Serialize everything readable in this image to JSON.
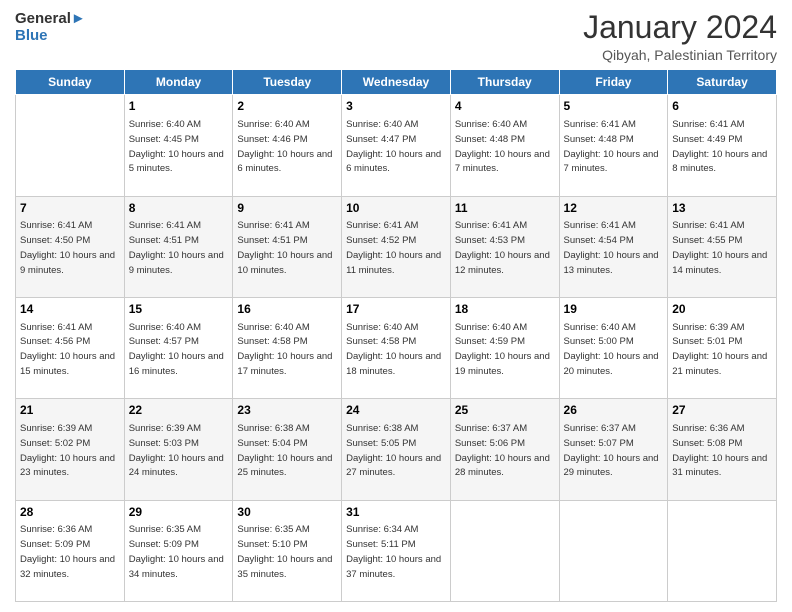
{
  "logo": {
    "text_general": "General",
    "text_blue": "Blue"
  },
  "header": {
    "month_year": "January 2024",
    "location": "Qibyah, Palestinian Territory"
  },
  "days_of_week": [
    "Sunday",
    "Monday",
    "Tuesday",
    "Wednesday",
    "Thursday",
    "Friday",
    "Saturday"
  ],
  "weeks": [
    [
      {
        "day": "",
        "sunrise": "",
        "sunset": "",
        "daylight": ""
      },
      {
        "day": "1",
        "sunrise": "Sunrise: 6:40 AM",
        "sunset": "Sunset: 4:45 PM",
        "daylight": "Daylight: 10 hours and 5 minutes."
      },
      {
        "day": "2",
        "sunrise": "Sunrise: 6:40 AM",
        "sunset": "Sunset: 4:46 PM",
        "daylight": "Daylight: 10 hours and 6 minutes."
      },
      {
        "day": "3",
        "sunrise": "Sunrise: 6:40 AM",
        "sunset": "Sunset: 4:47 PM",
        "daylight": "Daylight: 10 hours and 6 minutes."
      },
      {
        "day": "4",
        "sunrise": "Sunrise: 6:40 AM",
        "sunset": "Sunset: 4:48 PM",
        "daylight": "Daylight: 10 hours and 7 minutes."
      },
      {
        "day": "5",
        "sunrise": "Sunrise: 6:41 AM",
        "sunset": "Sunset: 4:48 PM",
        "daylight": "Daylight: 10 hours and 7 minutes."
      },
      {
        "day": "6",
        "sunrise": "Sunrise: 6:41 AM",
        "sunset": "Sunset: 4:49 PM",
        "daylight": "Daylight: 10 hours and 8 minutes."
      }
    ],
    [
      {
        "day": "7",
        "sunrise": "Sunrise: 6:41 AM",
        "sunset": "Sunset: 4:50 PM",
        "daylight": "Daylight: 10 hours and 9 minutes."
      },
      {
        "day": "8",
        "sunrise": "Sunrise: 6:41 AM",
        "sunset": "Sunset: 4:51 PM",
        "daylight": "Daylight: 10 hours and 9 minutes."
      },
      {
        "day": "9",
        "sunrise": "Sunrise: 6:41 AM",
        "sunset": "Sunset: 4:51 PM",
        "daylight": "Daylight: 10 hours and 10 minutes."
      },
      {
        "day": "10",
        "sunrise": "Sunrise: 6:41 AM",
        "sunset": "Sunset: 4:52 PM",
        "daylight": "Daylight: 10 hours and 11 minutes."
      },
      {
        "day": "11",
        "sunrise": "Sunrise: 6:41 AM",
        "sunset": "Sunset: 4:53 PM",
        "daylight": "Daylight: 10 hours and 12 minutes."
      },
      {
        "day": "12",
        "sunrise": "Sunrise: 6:41 AM",
        "sunset": "Sunset: 4:54 PM",
        "daylight": "Daylight: 10 hours and 13 minutes."
      },
      {
        "day": "13",
        "sunrise": "Sunrise: 6:41 AM",
        "sunset": "Sunset: 4:55 PM",
        "daylight": "Daylight: 10 hours and 14 minutes."
      }
    ],
    [
      {
        "day": "14",
        "sunrise": "Sunrise: 6:41 AM",
        "sunset": "Sunset: 4:56 PM",
        "daylight": "Daylight: 10 hours and 15 minutes."
      },
      {
        "day": "15",
        "sunrise": "Sunrise: 6:40 AM",
        "sunset": "Sunset: 4:57 PM",
        "daylight": "Daylight: 10 hours and 16 minutes."
      },
      {
        "day": "16",
        "sunrise": "Sunrise: 6:40 AM",
        "sunset": "Sunset: 4:58 PM",
        "daylight": "Daylight: 10 hours and 17 minutes."
      },
      {
        "day": "17",
        "sunrise": "Sunrise: 6:40 AM",
        "sunset": "Sunset: 4:58 PM",
        "daylight": "Daylight: 10 hours and 18 minutes."
      },
      {
        "day": "18",
        "sunrise": "Sunrise: 6:40 AM",
        "sunset": "Sunset: 4:59 PM",
        "daylight": "Daylight: 10 hours and 19 minutes."
      },
      {
        "day": "19",
        "sunrise": "Sunrise: 6:40 AM",
        "sunset": "Sunset: 5:00 PM",
        "daylight": "Daylight: 10 hours and 20 minutes."
      },
      {
        "day": "20",
        "sunrise": "Sunrise: 6:39 AM",
        "sunset": "Sunset: 5:01 PM",
        "daylight": "Daylight: 10 hours and 21 minutes."
      }
    ],
    [
      {
        "day": "21",
        "sunrise": "Sunrise: 6:39 AM",
        "sunset": "Sunset: 5:02 PM",
        "daylight": "Daylight: 10 hours and 23 minutes."
      },
      {
        "day": "22",
        "sunrise": "Sunrise: 6:39 AM",
        "sunset": "Sunset: 5:03 PM",
        "daylight": "Daylight: 10 hours and 24 minutes."
      },
      {
        "day": "23",
        "sunrise": "Sunrise: 6:38 AM",
        "sunset": "Sunset: 5:04 PM",
        "daylight": "Daylight: 10 hours and 25 minutes."
      },
      {
        "day": "24",
        "sunrise": "Sunrise: 6:38 AM",
        "sunset": "Sunset: 5:05 PM",
        "daylight": "Daylight: 10 hours and 27 minutes."
      },
      {
        "day": "25",
        "sunrise": "Sunrise: 6:37 AM",
        "sunset": "Sunset: 5:06 PM",
        "daylight": "Daylight: 10 hours and 28 minutes."
      },
      {
        "day": "26",
        "sunrise": "Sunrise: 6:37 AM",
        "sunset": "Sunset: 5:07 PM",
        "daylight": "Daylight: 10 hours and 29 minutes."
      },
      {
        "day": "27",
        "sunrise": "Sunrise: 6:36 AM",
        "sunset": "Sunset: 5:08 PM",
        "daylight": "Daylight: 10 hours and 31 minutes."
      }
    ],
    [
      {
        "day": "28",
        "sunrise": "Sunrise: 6:36 AM",
        "sunset": "Sunset: 5:09 PM",
        "daylight": "Daylight: 10 hours and 32 minutes."
      },
      {
        "day": "29",
        "sunrise": "Sunrise: 6:35 AM",
        "sunset": "Sunset: 5:09 PM",
        "daylight": "Daylight: 10 hours and 34 minutes."
      },
      {
        "day": "30",
        "sunrise": "Sunrise: 6:35 AM",
        "sunset": "Sunset: 5:10 PM",
        "daylight": "Daylight: 10 hours and 35 minutes."
      },
      {
        "day": "31",
        "sunrise": "Sunrise: 6:34 AM",
        "sunset": "Sunset: 5:11 PM",
        "daylight": "Daylight: 10 hours and 37 minutes."
      },
      {
        "day": "",
        "sunrise": "",
        "sunset": "",
        "daylight": ""
      },
      {
        "day": "",
        "sunrise": "",
        "sunset": "",
        "daylight": ""
      },
      {
        "day": "",
        "sunrise": "",
        "sunset": "",
        "daylight": ""
      }
    ]
  ]
}
